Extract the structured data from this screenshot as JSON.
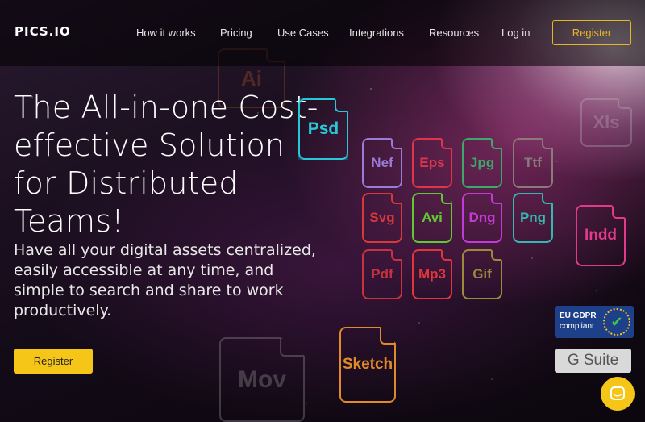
{
  "brand": {
    "logo_text": "PICS.IO"
  },
  "nav": {
    "links": [
      "How it works",
      "Pricing",
      "Use Cases",
      "Integrations",
      "Resources",
      "Log in"
    ],
    "register_label": "Register"
  },
  "hero": {
    "headline": "The All-in-one Cost-effective Solution for Distributed Teams!",
    "subtext": "Have all your digital assets centralized, easily accessible at any time, and simple to search and share to work productively.",
    "register_label": "Register"
  },
  "file_icons": [
    {
      "label": "Psd",
      "color": "#27c8d8"
    },
    {
      "label": "Nef",
      "color": "#9b7bd6"
    },
    {
      "label": "Eps",
      "color": "#e0334c"
    },
    {
      "label": "Jpg",
      "color": "#3ea86a"
    },
    {
      "label": "Ttf",
      "color": "#8a7a7a"
    },
    {
      "label": "Svg",
      "color": "#d9383a"
    },
    {
      "label": "Avi",
      "color": "#5fc832"
    },
    {
      "label": "Dng",
      "color": "#c33bd6"
    },
    {
      "label": "Png",
      "color": "#34b8b0"
    },
    {
      "label": "Indd",
      "color": "#e03b8a"
    },
    {
      "label": "Pdf",
      "color": "#c8323e"
    },
    {
      "label": "Mp3",
      "color": "#e0353a"
    },
    {
      "label": "Gif",
      "color": "#9a8a3a"
    },
    {
      "label": "Sketch",
      "color": "#e08a2a"
    },
    {
      "label": "Ai",
      "color": "#d8602a"
    },
    {
      "label": "Xls",
      "color": "#c8c8c8"
    },
    {
      "label": "Mov",
      "color": "#bbbbbb"
    }
  ],
  "badges": {
    "gdpr_title": "EU GDPR",
    "gdpr_subtitle": "compliant",
    "gsuite": "G Suite"
  },
  "icons": {
    "chat": "chat-icon",
    "gdpr_check": "check-icon"
  }
}
